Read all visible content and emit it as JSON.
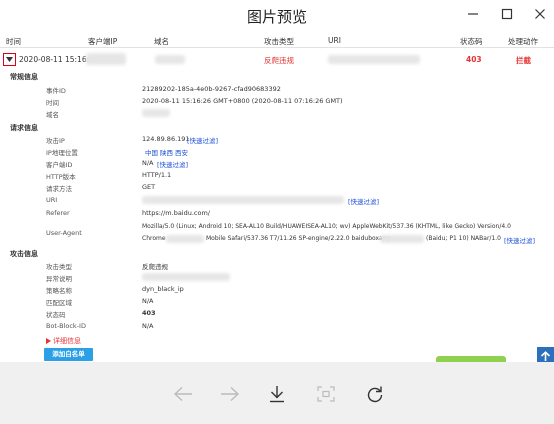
{
  "window": {
    "title": "图片预览"
  },
  "table": {
    "headers": [
      "时间",
      "客户端IP",
      "域名",
      "攻击类型",
      "URI",
      "状态码",
      "处理动作"
    ],
    "row": {
      "time": "2020-08-11 15:16:26",
      "attack_type": "反爬违规",
      "status_code": "403",
      "action": "拦截"
    }
  },
  "details": {
    "general": {
      "title": "常规信息",
      "event_id_label": "事件ID",
      "event_id": "21289202-185a-4e0b-9267-cfad90683392",
      "time_label": "时间",
      "time_value": "2020-08-11 15:16:26 GMT+0800 (2020-08-11 07:16:26 GMT)",
      "domain_label": "域名"
    },
    "request": {
      "title": "请求信息",
      "attack_ip_label": "攻击IP",
      "attack_ip": "124.89.86.191",
      "ip_geo_label": "IP地理位置",
      "ip_geo": [
        "中国",
        "陕西",
        "西安"
      ],
      "client_ip_label": "客户端ID",
      "client_ip": "N/A",
      "http_version_label": "HTTP版本",
      "http_version": "HTTP/1.1",
      "method_label": "请求方法",
      "method": "GET",
      "uri_label": "URI",
      "referer_label": "Referer",
      "referer": "https://m.baidu.com/",
      "ua_label": "User-Agent",
      "ua_line1": "Mozilla/5.0 (Linux; Android 10; SEA-AL10 Build/HUAWEISEA-AL10; wv) AppleWebKit/537.36 (KHTML, like Gecko) Version/4.0",
      "ua_line2_a": "Chrome",
      "ua_line2_b": "Mobile Safari/537.36 T7/11.26 SP-engine/2.22.0 baiduboxapp",
      "ua_line2_c": "(Baidu; P1 10) NABar/1.0"
    },
    "attack": {
      "title": "攻击信息",
      "attack_type_label": "攻击类型",
      "attack_type": "反爬违规",
      "anomaly_label": "异常说明",
      "rule_name_label": "策略名称",
      "rule_name": "dyn_black_ip",
      "match_area_label": "匹配区域",
      "match_area": "N/A",
      "status_label": "状态码",
      "status": "403",
      "bot_block_label": "Bot-Block-ID",
      "bot_block": "N/A"
    },
    "detail_toggle": "详细信息",
    "quick_filter": "[快速过滤]",
    "add_whitelist": "添加白名单"
  },
  "toolbar": {
    "icons": [
      "arrow-left-icon",
      "arrow-right-icon",
      "download-icon",
      "fit-screen-icon",
      "rotate-icon"
    ]
  },
  "colors": {
    "accent_red": "#e53333",
    "link_blue": "#1a4fd6",
    "button_blue": "#2ba0e6",
    "toolbar_bg": "#f0f0f0"
  }
}
